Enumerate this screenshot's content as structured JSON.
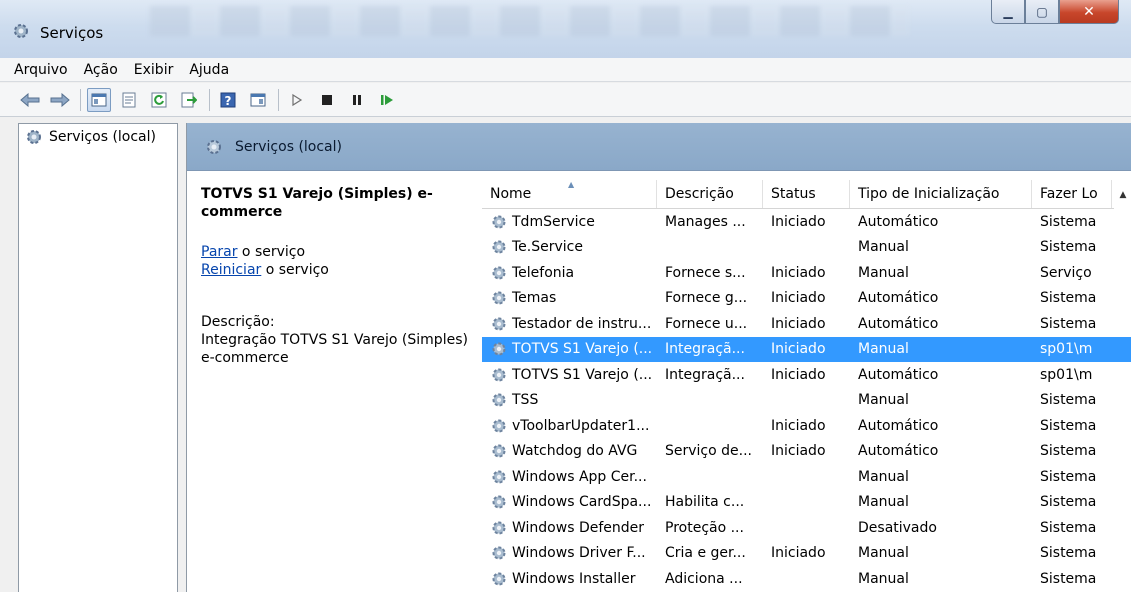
{
  "window": {
    "title": "Serviços"
  },
  "menu": {
    "items": [
      "Arquivo",
      "Ação",
      "Exibir",
      "Ajuda"
    ]
  },
  "tree": {
    "root_label": "Serviços (local)"
  },
  "panel": {
    "title": "Serviços (local)"
  },
  "detail": {
    "service_name": "TOTVS S1 Varejo (Simples) e-commerce",
    "stop_link": "Parar",
    "stop_suffix": " o serviço",
    "restart_link": "Reiniciar",
    "restart_suffix": " o serviço",
    "description_label": "Descrição:",
    "description_text": "Integração TOTVS S1 Varejo (Simples) e-commerce"
  },
  "columns": [
    "Nome",
    "Descrição",
    "Status",
    "Tipo de Inicialização",
    "Fazer Lo"
  ],
  "rows": [
    {
      "name": "TdmService",
      "desc": "Manages ...",
      "status": "Iniciado",
      "startup": "Automático",
      "logon": "Sistema"
    },
    {
      "name": "Te.Service",
      "desc": "",
      "status": "",
      "startup": "Manual",
      "logon": "Sistema"
    },
    {
      "name": "Telefonia",
      "desc": "Fornece s...",
      "status": "Iniciado",
      "startup": "Manual",
      "logon": "Serviço"
    },
    {
      "name": "Temas",
      "desc": "Fornece g...",
      "status": "Iniciado",
      "startup": "Automático",
      "logon": "Sistema"
    },
    {
      "name": "Testador de instru...",
      "desc": "Fornece u...",
      "status": "Iniciado",
      "startup": "Automático",
      "logon": "Sistema"
    },
    {
      "name": "TOTVS S1 Varejo (...",
      "desc": "Integraçã...",
      "status": "Iniciado",
      "startup": "Manual",
      "logon": "sp01\\m",
      "selected": true
    },
    {
      "name": "TOTVS S1 Varejo (...",
      "desc": "Integraçã...",
      "status": "Iniciado",
      "startup": "Automático",
      "logon": "sp01\\m"
    },
    {
      "name": "TSS",
      "desc": "",
      "status": "",
      "startup": "Manual",
      "logon": "Sistema"
    },
    {
      "name": "vToolbarUpdater1...",
      "desc": "",
      "status": "Iniciado",
      "startup": "Automático",
      "logon": "Sistema"
    },
    {
      "name": "Watchdog do AVG",
      "desc": "Serviço de...",
      "status": "Iniciado",
      "startup": "Automático",
      "logon": "Sistema"
    },
    {
      "name": "Windows App Cer...",
      "desc": "",
      "status": "",
      "startup": "Manual",
      "logon": "Sistema"
    },
    {
      "name": "Windows CardSpa...",
      "desc": "Habilita c...",
      "status": "",
      "startup": "Manual",
      "logon": "Sistema"
    },
    {
      "name": "Windows Defender",
      "desc": "Proteção ...",
      "status": "",
      "startup": "Desativado",
      "logon": "Sistema"
    },
    {
      "name": "Windows Driver F...",
      "desc": "Cria e ger...",
      "status": "Iniciado",
      "startup": "Manual",
      "logon": "Sistema"
    },
    {
      "name": "Windows Installer",
      "desc": "Adiciona ...",
      "status": "",
      "startup": "Manual",
      "logon": "Sistema"
    }
  ],
  "colors": {
    "selection": "#3399ff",
    "header": "#8aa8c8",
    "link": "#0645ad"
  }
}
